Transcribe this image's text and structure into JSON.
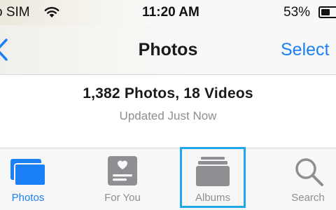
{
  "status_bar": {
    "carrier": "o SIM",
    "time": "11:20 AM",
    "battery_percent": "53%",
    "battery_level": 0.53,
    "wifi_icon": "wifi-icon",
    "battery_icon": "battery-icon"
  },
  "nav_bar": {
    "back_icon": "chevron-left-icon",
    "title": "Photos",
    "select_label": "Select"
  },
  "summary": {
    "count": "1,382 Photos, 18 Videos",
    "updated": "Updated Just Now"
  },
  "tab_bar": {
    "tabs": [
      {
        "label": "Photos",
        "icon": "photos-icon",
        "active": true
      },
      {
        "label": "For You",
        "icon": "for-you-icon",
        "active": false
      },
      {
        "label": "Albums",
        "icon": "albums-icon",
        "active": false,
        "highlighted": true
      },
      {
        "label": "Search",
        "icon": "search-icon",
        "active": false
      }
    ]
  },
  "colors": {
    "accent": "#1b7ff5",
    "inactive": "#8e8e93",
    "highlight": "#1ea8ea",
    "icon_gray": "#8e8e93"
  }
}
